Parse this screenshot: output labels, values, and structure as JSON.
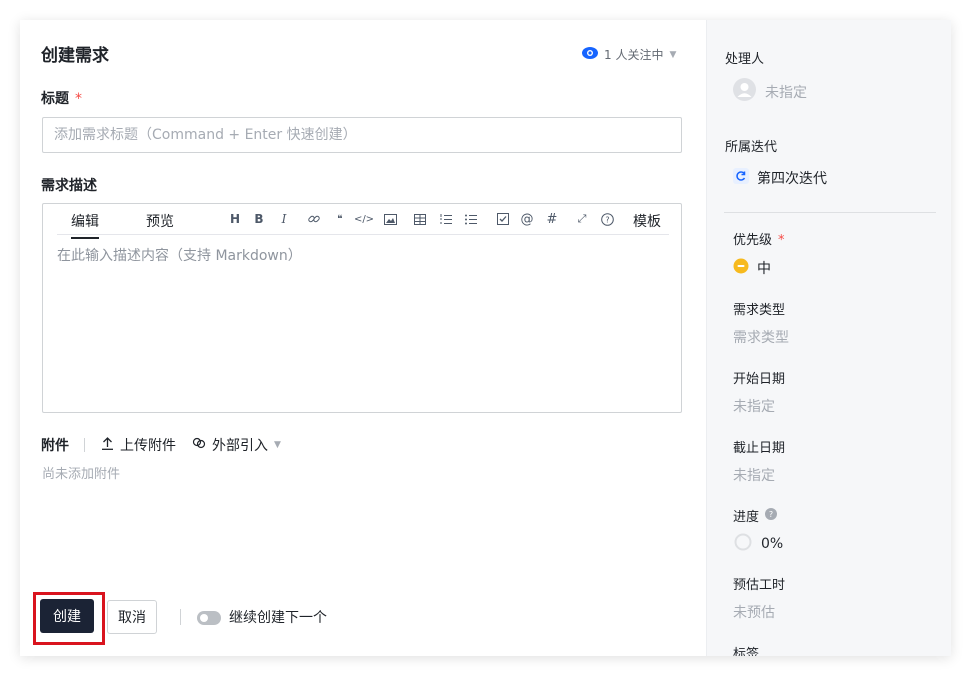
{
  "header": {
    "title": "创建需求",
    "watch_text": "1 人关注中"
  },
  "title_field": {
    "label": "标题",
    "required_mark": "*",
    "placeholder": "添加需求标题（Command + Enter 快速创建）"
  },
  "description": {
    "label": "需求描述",
    "tabs": [
      "编辑",
      "预览"
    ],
    "toolbar": [
      "H",
      "B",
      "I",
      "link",
      "quote",
      "code",
      "image",
      "table",
      "ordered-list",
      "bullet-list",
      "checkbox",
      "@",
      "#",
      "expand",
      "help"
    ],
    "template_label": "模板",
    "placeholder": "在此输入描述内容（支持 Markdown）"
  },
  "attachments": {
    "label": "附件",
    "upload_label": "上传附件",
    "external_label": "外部引入",
    "empty_text": "尚未添加附件"
  },
  "footer": {
    "create_label": "创建",
    "cancel_label": "取消",
    "continue_label": "继续创建下一个",
    "continue_enabled": false
  },
  "sidebar": {
    "assignee": {
      "label": "处理人",
      "value": "未指定"
    },
    "iteration": {
      "label": "所属迭代",
      "value": "第四次迭代"
    },
    "priority": {
      "label": "优先级",
      "required_mark": "*",
      "value": "中",
      "color": "#f7ba1e"
    },
    "type": {
      "label": "需求类型",
      "value": "需求类型"
    },
    "start_date": {
      "label": "开始日期",
      "value": "未指定"
    },
    "due_date": {
      "label": "截止日期",
      "value": "未指定"
    },
    "progress": {
      "label": "进度",
      "value": "0%"
    },
    "estimate": {
      "label": "预估工时",
      "value": "未预估"
    },
    "tags": {
      "label": "标签"
    }
  },
  "colors": {
    "primary_button": "#1b2335",
    "highlight_border": "#d9141e",
    "watch_icon": "#1664ff",
    "iteration_icon": "#1664ff"
  }
}
